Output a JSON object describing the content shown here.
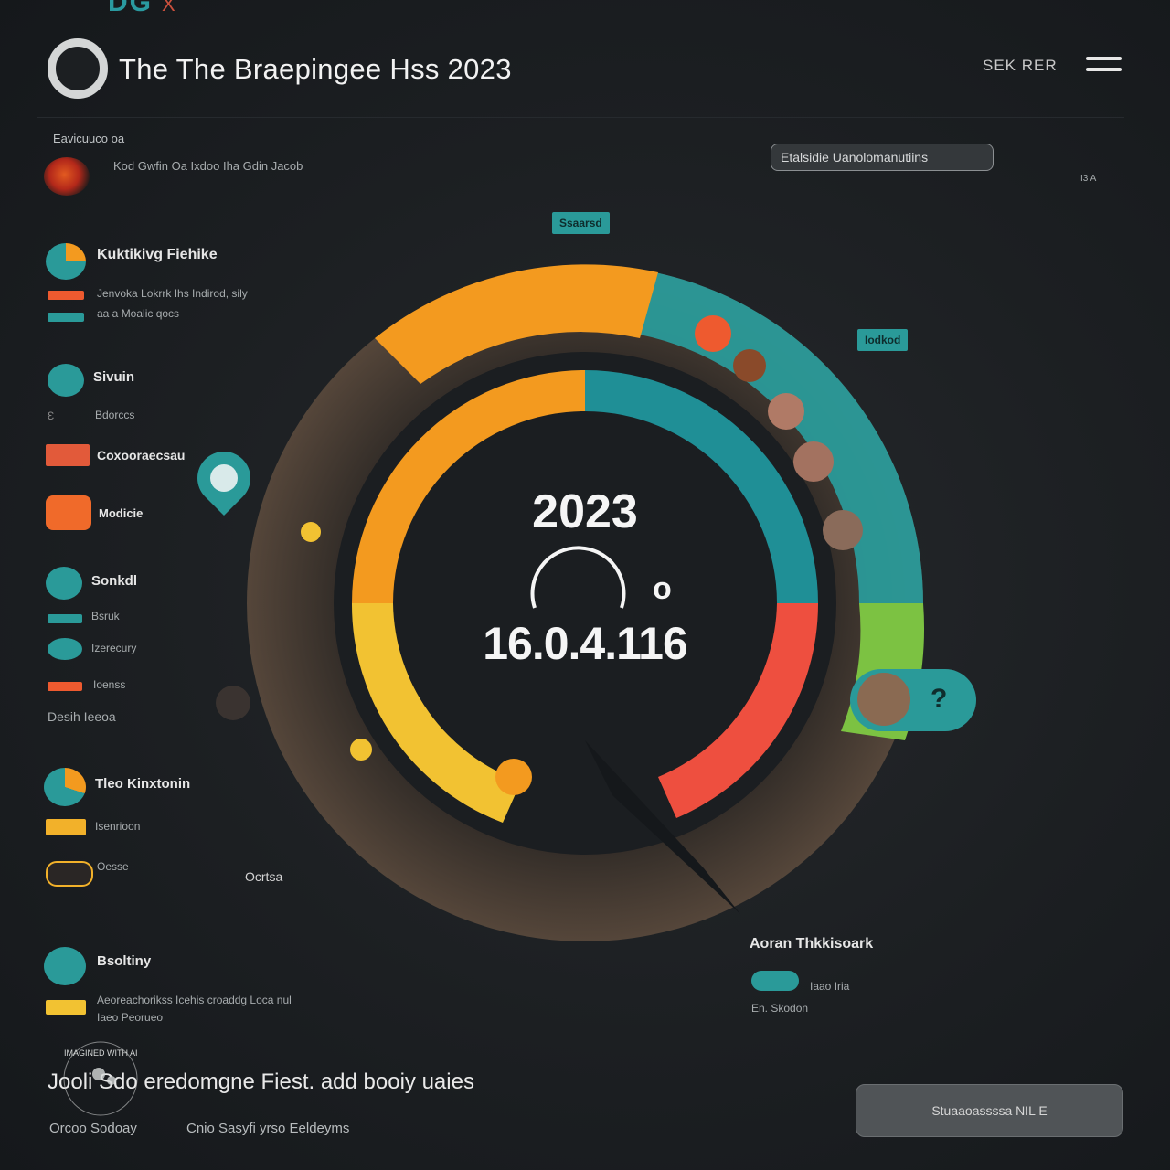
{
  "topfrag": {
    "text": "DG",
    "x": "X"
  },
  "header": {
    "title": "The The Braepingee Hss 2023",
    "right_text": "SEK RER"
  },
  "sidebar": {
    "section_label": "Eavicuuco oa",
    "intro_text": "Kod Gwfin Oa Ixdoo Iha Gdin Jacob",
    "items": [
      {
        "label": "Kuktikivg Fiehike",
        "sub1": "Jenvoka Lokrrk Ihs Indirod, sily",
        "sub2": "aa a Moalic qocs"
      },
      {
        "label": "Sivuin",
        "sub1": "Bdorccs"
      },
      {
        "label": "Coxooraecsau"
      },
      {
        "label": "Modicie"
      },
      {
        "label": "Sonkdl",
        "sub1": "Bsruk",
        "sub2": "Izerecury",
        "sub3": "Ioenss",
        "sub4": "Desih Ieeoa"
      },
      {
        "label": "Tleo Kinxtonin",
        "sub1": "Isenrioon",
        "sub2": "Oesse"
      },
      {
        "label": "Bsoltiny",
        "sub1": "Aeoreachorikss Icehis croaddg Loca nul",
        "sub2": "Iaeo Peorueo"
      }
    ]
  },
  "pill_label": "Etalsidie Uanolomanutiins",
  "tags": {
    "top": "Ssaarsd",
    "right": "Iodkod"
  },
  "center": {
    "year": "2023",
    "value": "16.0.4.116",
    "o": "o"
  },
  "small_labels": {
    "left": "Ocrtsa",
    "bottom_right_title": "Aoran Thkkisoark",
    "br1": "Iaao Iria",
    "br2": "En. Skodon",
    "tiny": "I3 A"
  },
  "footer": {
    "line": "Jooli Sdo  eredomgne Fiest.  add booiy uaies",
    "sub1": "Orcoo Sodoay",
    "sub2": "Cnio Sasyfi yrso Eeldeyms",
    "cta": "Stuaaoassssa NIL E"
  },
  "watermark": "IMAGINED WITH AI",
  "colors": {
    "teal": "#2a9a99",
    "orange": "#f39a1f",
    "red": "#ee4f3f",
    "yellow": "#f2c232",
    "green": "#7cc242",
    "bg": "#1c1f22"
  }
}
